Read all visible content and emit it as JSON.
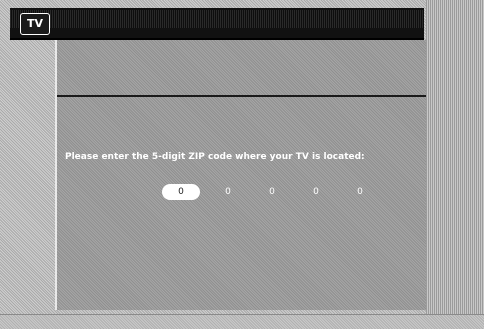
{
  "header": {
    "tv_badge": "TV",
    "title": ""
  },
  "panel": {
    "intro": "",
    "prompt": "Please enter the 5-digit ZIP code where your TV is located:",
    "zip_digits": [
      "0",
      "0",
      "0",
      "0",
      "0"
    ],
    "footer_note": ""
  },
  "statusbar": {
    "left": "",
    "right": ""
  }
}
